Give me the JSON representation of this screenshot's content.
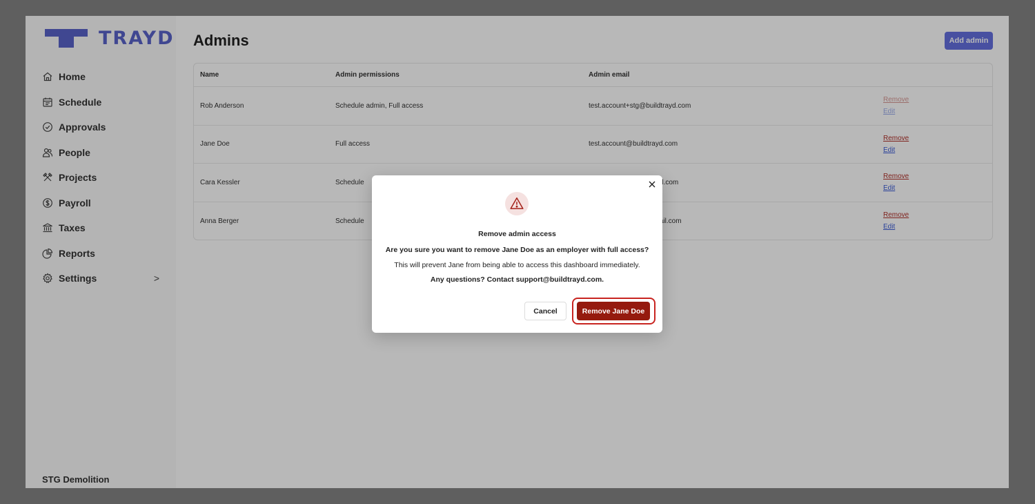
{
  "brand": {
    "name": "TRAYD",
    "color": "#5963c9"
  },
  "sidebar": {
    "items": [
      {
        "label": "Home",
        "icon": "home-icon"
      },
      {
        "label": "Schedule",
        "icon": "calendar-icon"
      },
      {
        "label": "Approvals",
        "icon": "check-circle-icon"
      },
      {
        "label": "People",
        "icon": "people-icon"
      },
      {
        "label": "Projects",
        "icon": "tools-icon"
      },
      {
        "label": "Payroll",
        "icon": "dollar-circle-icon"
      },
      {
        "label": "Taxes",
        "icon": "bank-icon"
      },
      {
        "label": "Reports",
        "icon": "pie-chart-icon"
      },
      {
        "label": "Settings",
        "icon": "gear-icon",
        "chevron": ">"
      }
    ],
    "org_name": "STG Demolition"
  },
  "page": {
    "title": "Admins",
    "add_button": "Add admin"
  },
  "table": {
    "headers": {
      "name": "Name",
      "permissions": "Admin permissions",
      "email": "Admin email"
    },
    "rows": [
      {
        "name": "Rob Anderson",
        "permissions": "Schedule admin, Full access",
        "email": "test.account+stg@buildtrayd.com",
        "remove": "Remove",
        "edit": "Edit"
      },
      {
        "name": "Jane Doe",
        "permissions": "Full access",
        "email": "test.account@buildtrayd.com",
        "remove": "Remove",
        "edit": "Edit"
      },
      {
        "name": "Cara Kessler",
        "permissions": "Schedule",
        "email": "nail.com",
        "remove": "Remove",
        "edit": "Edit"
      },
      {
        "name": "Anna Berger",
        "permissions": "Schedule",
        "email": "gmail.com",
        "remove": "Remove",
        "edit": "Edit"
      }
    ]
  },
  "modal": {
    "title": "Remove admin access",
    "question": "Are you sure you want to remove Jane Doe as an employer with full access?",
    "info": "This will prevent Jane from being able to access this dashboard immediately.",
    "contact": "Any questions? Contact support@buildtrayd.com.",
    "cancel_label": "Cancel",
    "confirm_label": "Remove Jane Doe",
    "confirm_color": "#951a0e"
  }
}
